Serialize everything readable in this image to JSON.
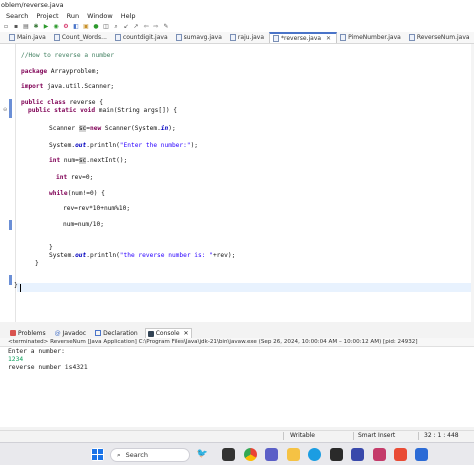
{
  "window": {
    "title": "oblem/reverse.java"
  },
  "menu": [
    "Search",
    "Project",
    "Run",
    "Window",
    "Help"
  ],
  "tabs": [
    {
      "label": "Main.java",
      "active": false
    },
    {
      "label": "Count_Words...",
      "active": false
    },
    {
      "label": "countdigit.java",
      "active": false
    },
    {
      "label": "sumavg.java",
      "active": false
    },
    {
      "label": "raju.java",
      "active": false
    },
    {
      "label": "*reverse.java",
      "active": true,
      "close": "✕"
    },
    {
      "label": "PimeNumber.java",
      "active": false
    },
    {
      "label": "ReverseNum.java",
      "active": false
    }
  ],
  "code": {
    "comment": "//How to reverse a number",
    "pkg_kw": "package",
    "pkg_name": " Arrayproblem;",
    "imp_kw": "import",
    "imp_name": " java.util.Scanner;",
    "cls_kw1": "public",
    "cls_kw2": " class",
    "cls_name": " reverse {",
    "main_kw1": "public",
    "main_kw2": " static",
    "main_kw3": " void",
    "main_rest": " main(String args[]) {",
    "sc_a": "Scanner ",
    "sc_var": "sc",
    "sc_eq": "=",
    "sc_new": "new",
    "sc_rest": " Scanner(System.",
    "sc_in": "in",
    "sc_end": ");",
    "p1_a": "System.",
    "p1_out": "out",
    "p1_b": ".println(",
    "p1_str": "\"Enter the number:\"",
    "p1_end": ");",
    "n_kw": "int",
    "n_a": " num=",
    "n_var": "sc",
    "n_b": ".nextInt();",
    "r_kw": "int",
    "r_a": " rev=0;",
    "w_kw": "while",
    "w_a": "(num!=0) {",
    "l1": "rev=rev*10+num%10;",
    "l2": "num=num/10;",
    "close1": "}",
    "p2_a": "System.",
    "p2_out": "out",
    "p2_b": ".println(",
    "p2_str": "\"the reverse number is: \"",
    "p2_end": "+rev);",
    "close2": "}",
    "close3": "}"
  },
  "panel": {
    "tabs": [
      "Problems",
      "Javadoc",
      "Declaration",
      "Console"
    ],
    "close": "✕",
    "console_header": "<terminated> ReverseNum [Java Application] C:\\Program Files\\Java\\jdk-21\\bin\\javaw.exe  (Sep 26, 2024, 10:00:04 AM – 10:00:12 AM) [pid: 24932]",
    "lines": [
      "Enter a number:",
      "1234",
      "reverse number is4321"
    ]
  },
  "status": {
    "writable": "Writable",
    "insert": "Smart Insert",
    "position": "32 : 1 : 448"
  },
  "taskbar": {
    "search_placeholder": "Search"
  }
}
